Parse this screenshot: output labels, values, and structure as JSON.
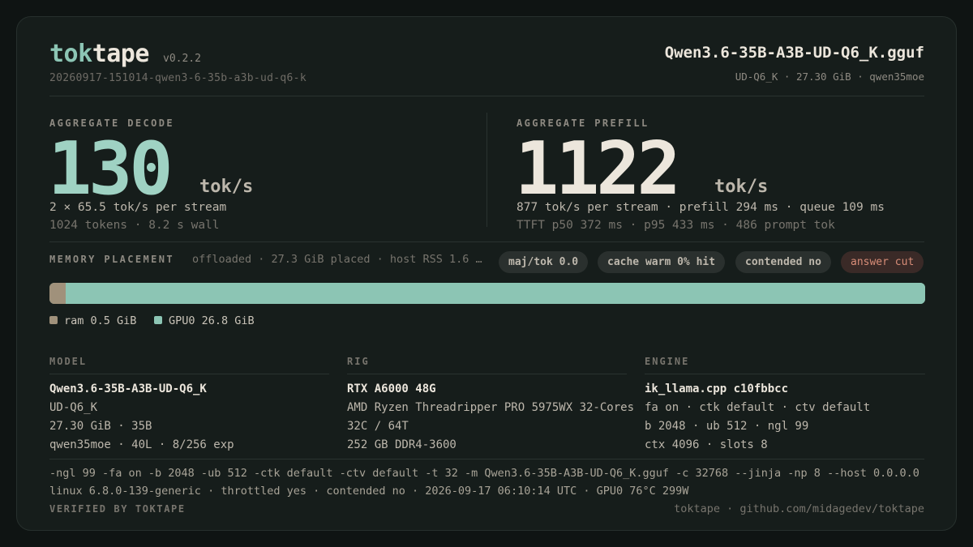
{
  "header": {
    "brand_part1": "tok",
    "brand_part2": "tape",
    "version": "v0.2.2",
    "run_id": "20260917-151014-qwen3-6-35b-a3b-ud-q6-k",
    "model_file": "Qwen3.6-35B-A3B-UD-Q6_K.gguf",
    "model_meta": "UD-Q6_K · 27.30 GiB · qwen35moe"
  },
  "decode": {
    "label": "AGGREGATE DECODE",
    "value": "130",
    "unit": "tok/s",
    "line1": "2 × 65.5 tok/s per stream",
    "line2": "1024 tokens · 8.2 s wall"
  },
  "prefill": {
    "label": "AGGREGATE PREFILL",
    "value": "1122",
    "unit": "tok/s",
    "line1": "877 tok/s per stream · prefill 294 ms · queue 109 ms",
    "line2": "TTFT p50 372 ms · p95 433 ms · 486 prompt tok"
  },
  "memory": {
    "label": "MEMORY PLACEMENT",
    "summary": "offloaded · 27.3 GiB placed · host RSS 1.6 …",
    "badges": [
      {
        "text": "maj/tok 0.0",
        "kind": "normal"
      },
      {
        "text": "cache warm 0% hit",
        "kind": "normal"
      },
      {
        "text": "contended no",
        "kind": "normal"
      },
      {
        "text": "answer cut",
        "kind": "warn"
      }
    ],
    "segments": [
      {
        "name": "ram",
        "gib": 0.5,
        "color": "#a0917b"
      },
      {
        "name": "GPU0",
        "gib": 26.8,
        "color": "#8cc5b4"
      }
    ],
    "legend": [
      {
        "text": "ram 0.5 GiB",
        "color": "#a0917b"
      },
      {
        "text": "GPU0 26.8 GiB",
        "color": "#8cc5b4"
      }
    ]
  },
  "details": {
    "model": {
      "heading": "MODEL",
      "lines": [
        "Qwen3.6-35B-A3B-UD-Q6_K",
        "UD-Q6_K",
        "27.30 GiB · 35B",
        "qwen35moe · 40L · 8/256 exp"
      ]
    },
    "rig": {
      "heading": "RIG",
      "lines": [
        "RTX A6000 48G",
        "AMD Ryzen Threadripper PRO 5975WX 32-Cores",
        "32C / 64T",
        "252 GB DDR4-3600"
      ]
    },
    "engine": {
      "heading": "ENGINE",
      "lines": [
        "ik_llama.cpp c10fbbcc",
        "fa on · ctk default · ctv default",
        "b 2048 · ub 512 · ngl 99",
        "ctx 4096 · slots 8"
      ]
    }
  },
  "footer": {
    "command": "-ngl 99  -fa on  -b 2048  -ub 512  -ctk default  -ctv default  -t 32  -m Qwen3.6-35B-A3B-UD-Q6_K.gguf  -c 32768  --jinja  -np 8  --host 0.0.0.0",
    "environment": "linux 6.8.0-139-generic · throttled yes · contended no · 2026-09-17 06:10:14 UTC · GPU0 76°C 299W",
    "verified": "VERIFIED BY TOKTAPE",
    "link": "toktape · github.com/midagedev/toktape"
  }
}
